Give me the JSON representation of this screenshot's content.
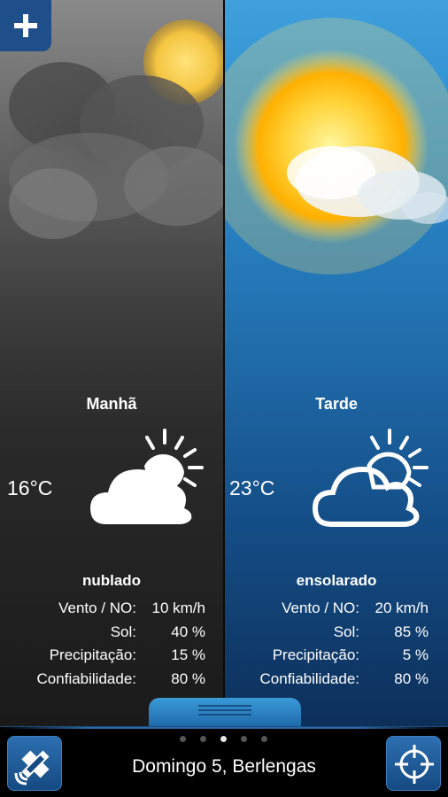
{
  "header": {
    "add_icon": "plus-icon"
  },
  "left": {
    "period": "Manhã",
    "temperature": "16°C",
    "icon": "cloud-sun-icon",
    "condition": "nublado",
    "stats": [
      {
        "label": "Vento / NO:",
        "value": "10 km/h"
      },
      {
        "label": "Sol:",
        "value": "40 %"
      },
      {
        "label": "Precipitação:",
        "value": "15 %"
      },
      {
        "label": "Confiabilidade:",
        "value": "80 %"
      }
    ]
  },
  "right": {
    "period": "Tarde",
    "temperature": "23°C",
    "icon": "cloud-sun-icon",
    "condition": "ensolarado",
    "stats": [
      {
        "label": "Vento / NO:",
        "value": "20 km/h"
      },
      {
        "label": "Sol:",
        "value": "85 %"
      },
      {
        "label": "Precipitação:",
        "value": "5 %"
      },
      {
        "label": "Confiabilidade:",
        "value": "80 %"
      }
    ]
  },
  "footer": {
    "location": "Domingo 5, Berlengas",
    "left_button_icon": "satellite-icon",
    "right_button_icon": "crosshair-icon",
    "page_count": 5,
    "active_page": 3
  },
  "colors": {
    "accent": "#2a86c8",
    "button": "#1f4f8a"
  }
}
